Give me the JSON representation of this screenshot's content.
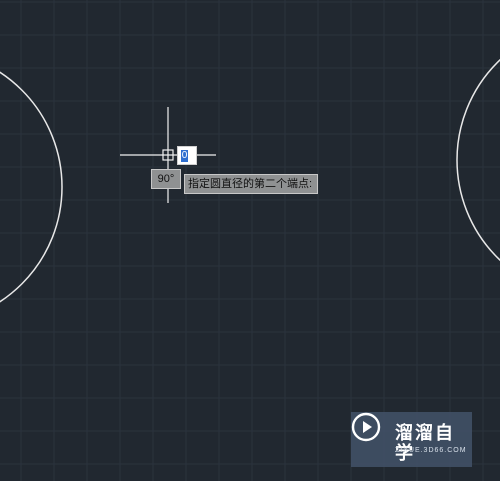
{
  "drawing_area": {
    "background": "#212830",
    "grid_color": "#2b333d",
    "circle_color": "#ffffff",
    "crosshair_color": "#ffffff"
  },
  "dynamic_input": {
    "angle_label": "90°",
    "prompt": "指定圆直径的第二个端点:",
    "input_value": "0"
  },
  "watermark": {
    "name": "溜溜自学",
    "url": "ZIXUE.3D66.COM",
    "icon": "play-icon"
  }
}
